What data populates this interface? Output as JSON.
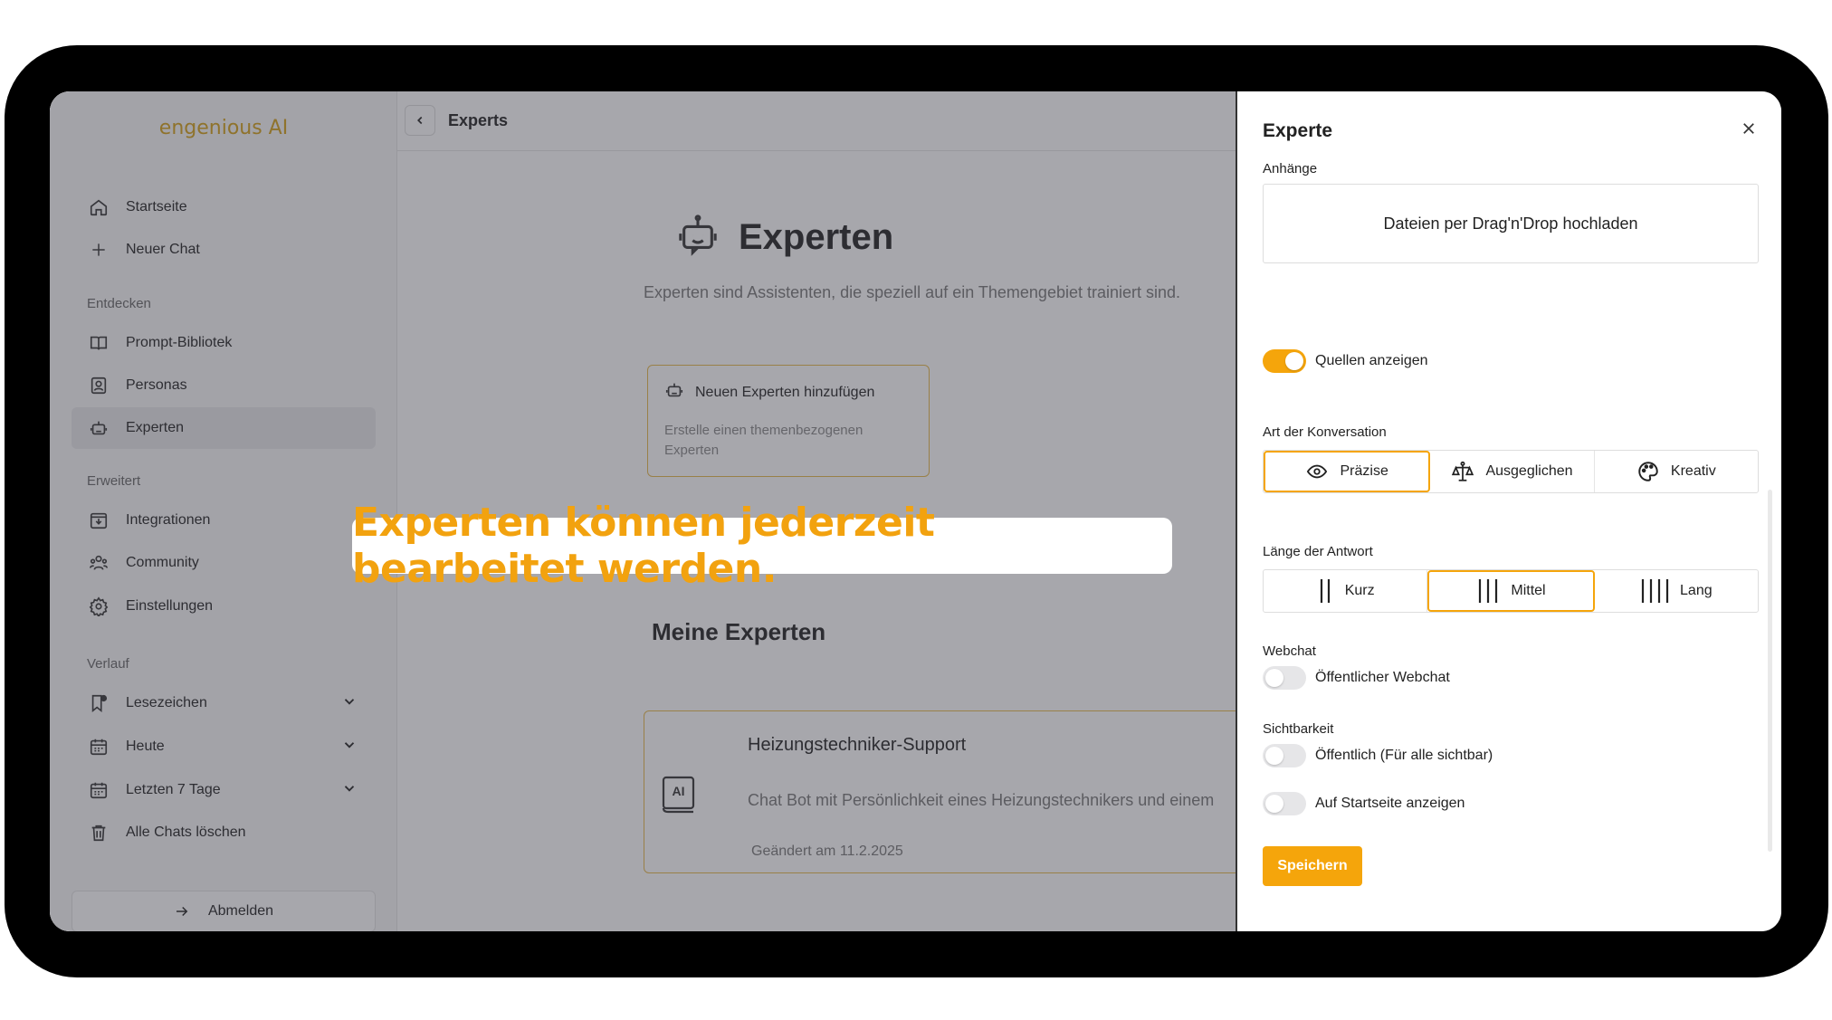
{
  "app": {
    "logo": "engenious AI"
  },
  "sidebar": {
    "top_items": [
      {
        "label": "Startseite",
        "icon": "home-icon"
      },
      {
        "label": "Neuer Chat",
        "icon": "plus-icon"
      }
    ],
    "sections": {
      "entdecken": "Entdecken",
      "erweitert": "Erweitert",
      "verlauf": "Verlauf"
    },
    "entdecken_items": [
      {
        "label": "Prompt-Bibliotek",
        "icon": "book-icon"
      },
      {
        "label": "Personas",
        "icon": "persona-icon"
      },
      {
        "label": "Experten",
        "icon": "robot-icon"
      }
    ],
    "erweitert_items": [
      {
        "label": "Integrationen",
        "icon": "integration-icon"
      },
      {
        "label": "Community",
        "icon": "community-icon"
      },
      {
        "label": "Einstellungen",
        "icon": "gear-icon"
      }
    ],
    "verlauf_items": [
      {
        "label": "Lesezeichen",
        "icon": "bookmark-icon"
      },
      {
        "label": "Heute",
        "icon": "calendar-icon"
      },
      {
        "label": "Letzten 7 Tage",
        "icon": "calendar-icon"
      },
      {
        "label": "Alle Chats löschen",
        "icon": "trash-icon"
      }
    ],
    "logout": "Abmelden"
  },
  "topbar": {
    "title": "Experts"
  },
  "main": {
    "title": "Experten",
    "subtitle": "Experten sind Assistenten, die speziell auf ein Themengebiet trainiert sind.",
    "new_card": {
      "title": "Neuen Experten hinzufügen",
      "desc": "Erstelle einen themenbezogenen Experten"
    },
    "my_title": "Meine Experten",
    "expert": {
      "name": "Heizungstechniker-Support",
      "desc": "Chat Bot mit Persönlichkeit eines Heizungstechnikers und einem",
      "avatar_text": "AI",
      "date": "Geändert am 11.2.2025"
    }
  },
  "caption": "Experten können jederzeit bearbeitet werden.",
  "drawer": {
    "title": "Experte",
    "attachments_label": "Anhänge",
    "dropzone": "Dateien per Drag'n'Drop hochladen",
    "sources_toggle": {
      "label": "Quellen anzeigen",
      "on": true
    },
    "conversation_label": "Art der Konversation",
    "conversation_options": [
      {
        "label": "Präzise",
        "icon": "eye-icon",
        "selected": true
      },
      {
        "label": "Ausgeglichen",
        "icon": "scale-icon",
        "selected": false
      },
      {
        "label": "Kreativ",
        "icon": "palette-icon",
        "selected": false
      }
    ],
    "length_label": "Länge der Antwort",
    "length_options": [
      {
        "label": "Kurz",
        "selected": false
      },
      {
        "label": "Mittel",
        "selected": true
      },
      {
        "label": "Lang",
        "selected": false
      }
    ],
    "webchat_label": "Webchat",
    "webchat_toggle": {
      "label": "Öffentlicher Webchat",
      "on": false
    },
    "visibility_label": "Sichtbarkeit",
    "public_toggle": {
      "label": "Öffentlich (Für alle sichtbar)",
      "on": false
    },
    "homepage_toggle": {
      "label": "Auf Startseite anzeigen",
      "on": false
    },
    "save": "Speichern"
  },
  "colors": {
    "accent": "#f5a50b",
    "logo": "#d4a017",
    "caption": "#f2a20f"
  }
}
